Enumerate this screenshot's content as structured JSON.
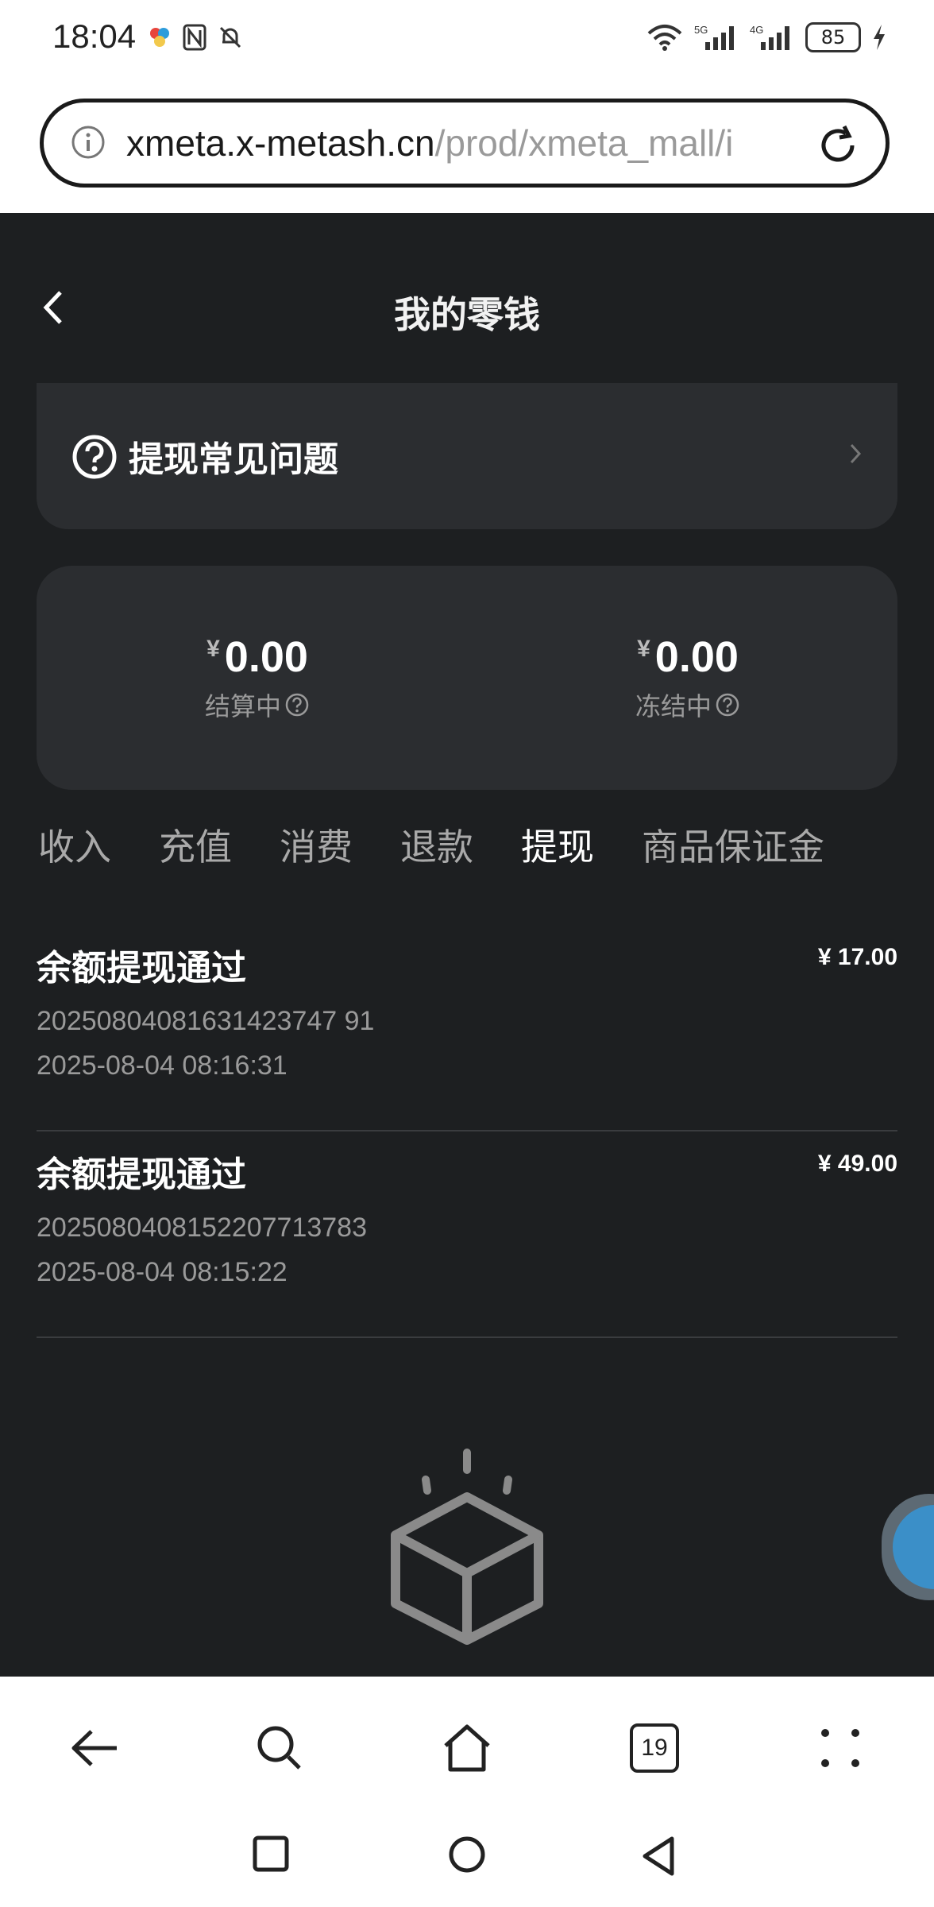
{
  "status_bar": {
    "time": "18:04",
    "network_labels": [
      "5G",
      "4G"
    ],
    "battery": "85"
  },
  "browser": {
    "url_host": "xmeta.x-metash.cn",
    "url_path": "/prod/xmeta_mall/i",
    "tab_count": "19"
  },
  "header": {
    "title": "我的零钱"
  },
  "faq": {
    "label": "提现常见问题"
  },
  "balance": {
    "currency": "¥",
    "settling_amount": "0.00",
    "settling_label": "结算中",
    "frozen_amount": "0.00",
    "frozen_label": "冻结中"
  },
  "tabs": [
    {
      "label": "收入",
      "active": false
    },
    {
      "label": "充值",
      "active": false
    },
    {
      "label": "消费",
      "active": false
    },
    {
      "label": "退款",
      "active": false
    },
    {
      "label": "提现",
      "active": true
    },
    {
      "label": "商品保证金",
      "active": false
    }
  ],
  "records": [
    {
      "title": "余额提现通过",
      "id": "20250804081631423747 91",
      "time": "2025-08-04 08:16:31",
      "amount": "¥ 17.00"
    },
    {
      "title": "余额提现通过",
      "id": "2025080408152207713783",
      "time": "2025-08-04 08:15:22",
      "amount": "¥ 49.00"
    }
  ]
}
